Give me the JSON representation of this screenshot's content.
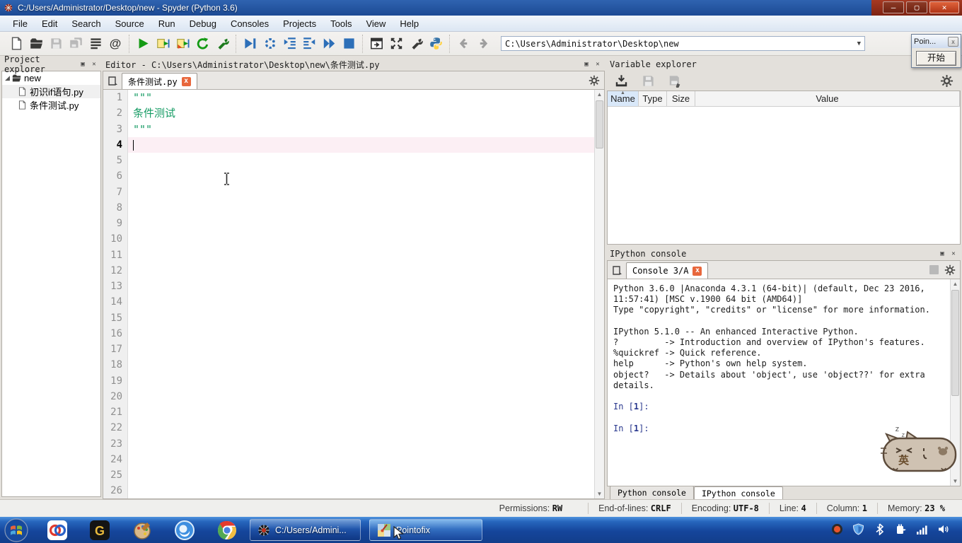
{
  "window": {
    "title": "C:/Users/Administrator/Desktop/new - Spyder (Python 3.6)",
    "minimize": "—",
    "maximize": "▢",
    "close": "✕"
  },
  "menu": {
    "items": [
      "File",
      "Edit",
      "Search",
      "Source",
      "Run",
      "Debug",
      "Consoles",
      "Projects",
      "Tools",
      "View",
      "Help"
    ]
  },
  "toolbar": {
    "groups": [
      [
        "new-file-icon",
        "open-file-icon",
        "save-icon",
        "save-all-icon",
        "file-switcher-icon",
        "symbol-finder-icon"
      ],
      [
        "run-icon",
        "run-cell-icon",
        "run-cell-advance-icon",
        "rerun-cell-icon",
        "configure-icon"
      ],
      [
        "debug-file-icon",
        "step-icon",
        "step-into-icon",
        "step-return-icon",
        "continue-icon",
        "stop-debug-icon"
      ],
      [
        "maximize-pane-icon",
        "fullscreen-icon",
        "tools-icon",
        "python-path-icon"
      ]
    ],
    "nav": [
      "back-icon",
      "forward-icon"
    ],
    "path_value": "C:\\Users\\Administrator\\Desktop\\new"
  },
  "project_explorer": {
    "title": "Project explorer",
    "root": "new",
    "files": [
      "初识if语句.py",
      "条件测试.py"
    ]
  },
  "editor": {
    "title": "Editor - C:\\Users\\Administrator\\Desktop\\new\\条件测试.py",
    "tab": "条件测试.py",
    "code_lines": [
      "\"\"\"",
      "条件测试",
      "\"\"\""
    ],
    "line_count": 26,
    "current_line": 4
  },
  "variable_explorer": {
    "title": "Variable explorer",
    "columns": [
      "Name",
      "Type",
      "Size",
      "Value"
    ],
    "tools": [
      "import-data-icon",
      "save-data-icon",
      "save-data-as-icon"
    ],
    "rows": []
  },
  "console": {
    "title": "IPython console",
    "tab": "Console 3/A",
    "banner": "Python 3.6.0 |Anaconda 4.3.1 (64-bit)| (default, Dec 23 2016,\n11:57:41) [MSC v.1900 64 bit (AMD64)]\nType \"copyright\", \"credits\" or \"license\" for more information.\n\nIPython 5.1.0 -- An enhanced Interactive Python.\n?         -> Introduction and overview of IPython's features.\n%quickref -> Quick reference.\nhelp      -> Python's own help system.\nobject?   -> Details about 'object', use 'object??' for extra\ndetails.",
    "prompts": [
      {
        "pre": "In [",
        "num": "1",
        "suf": "]:"
      },
      {
        "pre": "In [",
        "num": "1",
        "suf": "]:"
      }
    ],
    "bottom_tabs": [
      "Python console",
      "IPython console"
    ],
    "active_bottom_tab": "IPython console"
  },
  "statusbar": {
    "items": [
      {
        "label": "Permissions:",
        "value": "RW"
      },
      {
        "label": "End-of-lines:",
        "value": "CRLF"
      },
      {
        "label": "Encoding:",
        "value": "UTF-8"
      },
      {
        "label": "Line:",
        "value": "4"
      },
      {
        "label": "Column:",
        "value": "1"
      },
      {
        "label": "Memory:",
        "value": "23 %"
      }
    ]
  },
  "pointofix": {
    "title": "Poin...",
    "close": "x",
    "start_button": "开始"
  },
  "cat_widget": {
    "sleep_text": "z",
    "mode_label": "英"
  },
  "taskbar": {
    "quick_launch": [
      "start-orb-icon",
      "remote-app-icon",
      "g-app-icon",
      "palette-app-icon",
      "browser-app-icon",
      "chrome-icon"
    ],
    "buttons": [
      {
        "icon": "spyder-icon",
        "label": "C:/Users/Admini...",
        "state": "active"
      },
      {
        "icon": "pointofix-icon",
        "label": "Pointofix",
        "state": "hover"
      }
    ],
    "tray": [
      "record-icon",
      "shield-icon",
      "bluetooth-icon",
      "power-plug-icon",
      "network-signal-icon",
      "volume-icon"
    ]
  },
  "colors": {
    "accent_green": "#149b63",
    "prompt_navy": "#2b3a8f",
    "close_orange": "#e8673c",
    "titlebar_blue": "#1c4a94",
    "taskbar_blue": "#15459b"
  }
}
